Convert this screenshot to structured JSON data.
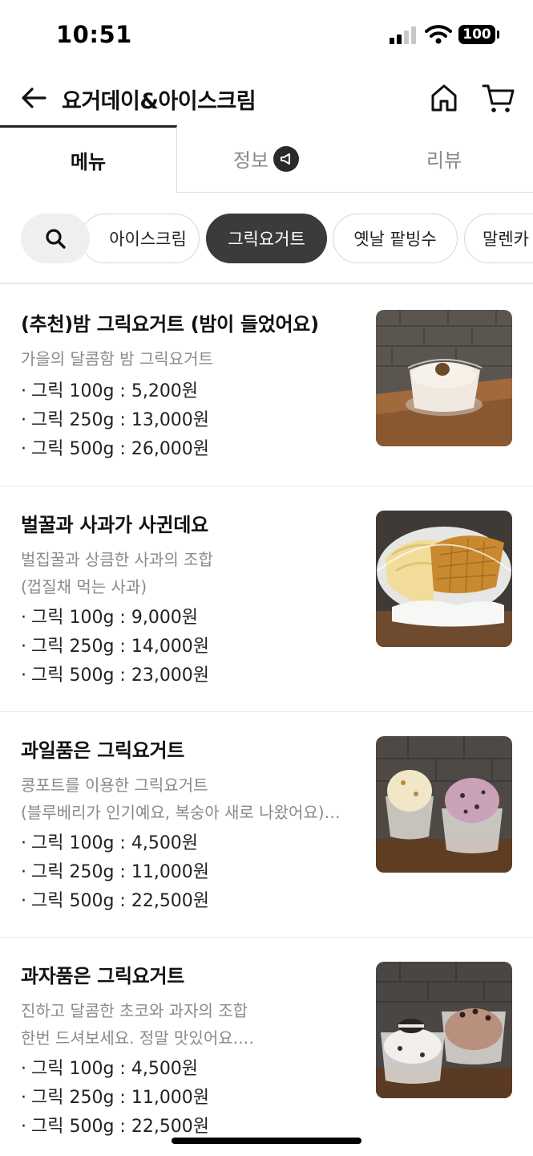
{
  "status_bar": {
    "time": "10:51",
    "battery": "100",
    "icons": [
      "signal-icon",
      "wifi-icon",
      "battery-icon"
    ]
  },
  "header": {
    "title": "요거데이&아이스크림",
    "icons": [
      "back-arrow-icon",
      "home-icon",
      "cart-icon"
    ]
  },
  "tabs": [
    {
      "label": "메뉴",
      "selected": true
    },
    {
      "label": "정보",
      "selected": false,
      "icon": "megaphone-icon"
    },
    {
      "label": "리뷰",
      "selected": false
    }
  ],
  "categories": {
    "search_icon": "search-icon",
    "items": [
      {
        "label": "아이스크림",
        "selected": false
      },
      {
        "label": "그릭요거트",
        "selected": true
      },
      {
        "label": "옛날 팥빙수",
        "selected": false
      },
      {
        "label": "말렌카",
        "selected": false
      }
    ]
  },
  "menu": [
    {
      "name": "(추천)밤 그릭요거트 (밤이 들었어요)",
      "description": [
        "가을의 달콤함 밤 그릭요거트"
      ],
      "prices": [
        "그릭 100g : 5,200원",
        "그릭 250g : 13,000원",
        "그릭 500g : 26,000원"
      ]
    },
    {
      "name": "벌꿀과 사과가 사귄데요",
      "description": [
        "벌집꿀과 상큼한 사과의 조합",
        "(껍질채 먹는 사과)"
      ],
      "prices": [
        "그릭 100g : 9,000원",
        "그릭 250g : 14,000원",
        "그릭 500g : 23,000원"
      ]
    },
    {
      "name": "과일품은 그릭요거트",
      "description": [
        "콩포트를 이용한 그릭요거트",
        "(블루베리가 인기예요, 복숭아 새로 나왔어요)…"
      ],
      "prices": [
        "그릭 100g : 4,500원",
        "그릭 250g : 11,000원",
        "그릭 500g : 22,500원"
      ]
    },
    {
      "name": "과자품은 그릭요거트",
      "description": [
        "진하고 달콤한 초코와 과자의 조합",
        "한번 드셔보세요. 정말 맛있어요.…"
      ],
      "prices": [
        "그릭 100g : 4,500원",
        "그릭 250g : 11,000원",
        "그릭 500g : 22,500원"
      ]
    }
  ],
  "bullet": "·"
}
